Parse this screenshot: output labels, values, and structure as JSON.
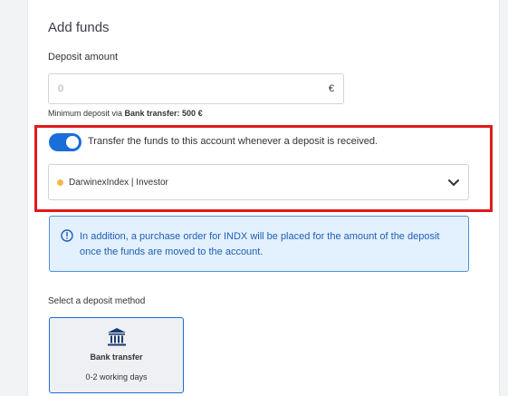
{
  "section": {
    "title": "Add funds"
  },
  "deposit": {
    "label": "Deposit amount",
    "placeholder": "0",
    "currency": "€",
    "minimum_prefix": "Minimum deposit via ",
    "minimum_bold": "Bank transfer: 500 €"
  },
  "auto_transfer": {
    "enabled": true,
    "label": "Transfer the funds to this account whenever a deposit is received.",
    "account": "DarwinexIndex | Investor",
    "account_dot_color": "#f2b84b"
  },
  "info": {
    "text": "In addition, a purchase order for INDX will be placed for the amount of the deposit once the funds are moved to the account.",
    "icon": "info-circle-icon"
  },
  "method": {
    "label": "Select a deposit method",
    "options": [
      {
        "name": "Bank transfer",
        "duration": "0-2 working days",
        "icon": "bank-icon",
        "selected": true
      }
    ]
  },
  "colors": {
    "accent": "#1a6ed8",
    "highlight": "#e01b1b",
    "info_bg": "#e3f0fd",
    "info_text": "#1e5fb4"
  }
}
